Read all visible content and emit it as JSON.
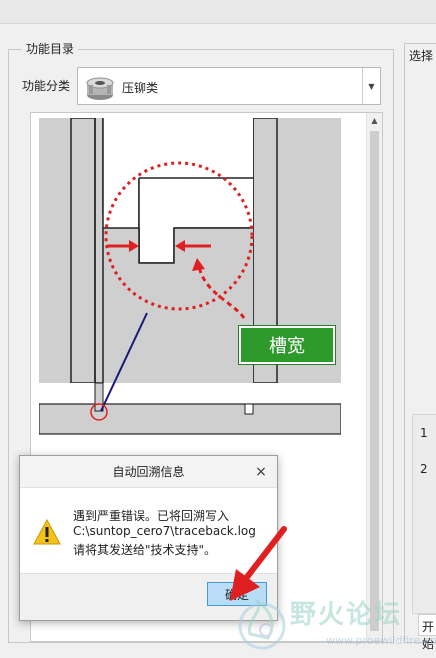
{
  "panel": {
    "title": "功能目录",
    "category_label": "功能分类",
    "category_value": "压铆类"
  },
  "diagram": {
    "callout_label": "槽宽"
  },
  "right_panel": {
    "title": "选择",
    "rows": [
      "1",
      "2"
    ],
    "bottom_text": "开始"
  },
  "dialog": {
    "title": "自动回溯信息",
    "close": "×",
    "lines": [
      "遇到严重错误。已将回溯写入",
      "C:\\suntop_cero7\\traceback.log",
      "请将其发送给\"技术支持\"。"
    ],
    "ok_label": "确定"
  },
  "watermark": {
    "title": "野火论坛",
    "url": "www.proewildfire.cn"
  },
  "colors": {
    "callout_green": "#2d9a2b",
    "dialog_ok_fill": "#b9dcf7",
    "annotation_red": "#e02020"
  }
}
